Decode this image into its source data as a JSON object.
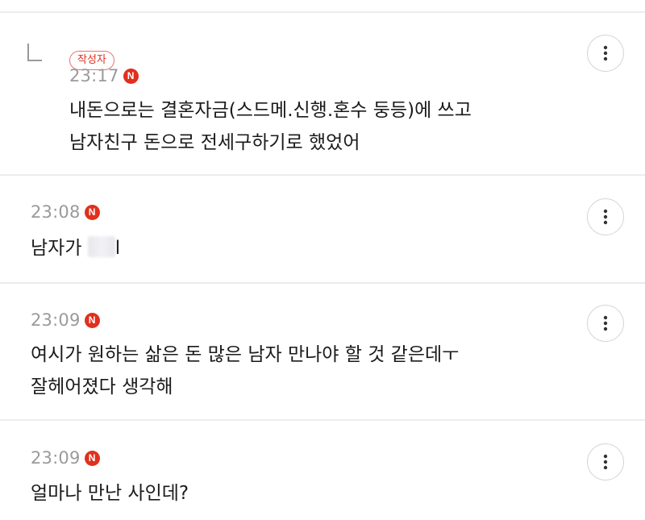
{
  "comments": [
    {
      "author_badge": "작성자",
      "time": "23:17",
      "new_badge": "N",
      "lines": [
        "내돈으로는 결혼자금(스드메.신행.혼수 둥등)에 쓰고",
        "남자친구 돈으로 전세구하기로 했었어"
      ],
      "is_reply": true
    },
    {
      "time": "23:08",
      "new_badge": "N",
      "text_before_redaction": "남자가 ",
      "text_after_redaction": "l"
    },
    {
      "time": "23:09",
      "new_badge": "N",
      "lines": [
        "여시가 원하는 삶은 돈 많은 남자 만나야 할 것 같은데ㅜ",
        "잘헤어졌다 생각해"
      ]
    },
    {
      "time": "23:09",
      "new_badge": "N",
      "lines": [
        "얼마나 만난 사인데?"
      ]
    }
  ],
  "icons": {
    "more": "more-vertical-icon",
    "reply": "reply-arrow-icon"
  },
  "colors": {
    "new_badge": "#e0301e",
    "author_badge_border": "#e57373",
    "divider": "#ececec",
    "time": "#9a9a9a"
  }
}
